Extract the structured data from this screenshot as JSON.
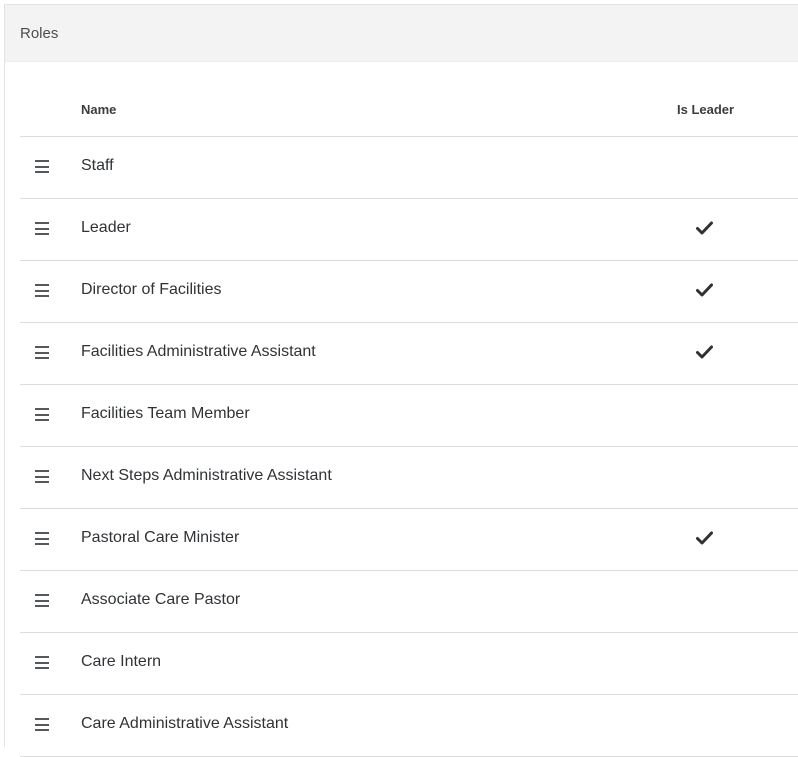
{
  "panel": {
    "title": "Roles"
  },
  "grid": {
    "columns": {
      "name": "Name",
      "is_leader": "Is Leader"
    },
    "rows": [
      {
        "name": "Staff",
        "is_leader": false
      },
      {
        "name": "Leader",
        "is_leader": true
      },
      {
        "name": "Director of Facilities",
        "is_leader": true
      },
      {
        "name": "Facilities Administrative Assistant",
        "is_leader": true
      },
      {
        "name": "Facilities Team Member",
        "is_leader": false
      },
      {
        "name": "Next Steps Administrative Assistant",
        "is_leader": false
      },
      {
        "name": "Pastoral Care Minister",
        "is_leader": true
      },
      {
        "name": "Associate Care Pastor",
        "is_leader": false
      },
      {
        "name": "Care Intern",
        "is_leader": false
      },
      {
        "name": "Care Administrative Assistant",
        "is_leader": false
      }
    ]
  },
  "icons": {
    "reorder": "reorder-handle-icon",
    "check": "checkmark-icon"
  }
}
